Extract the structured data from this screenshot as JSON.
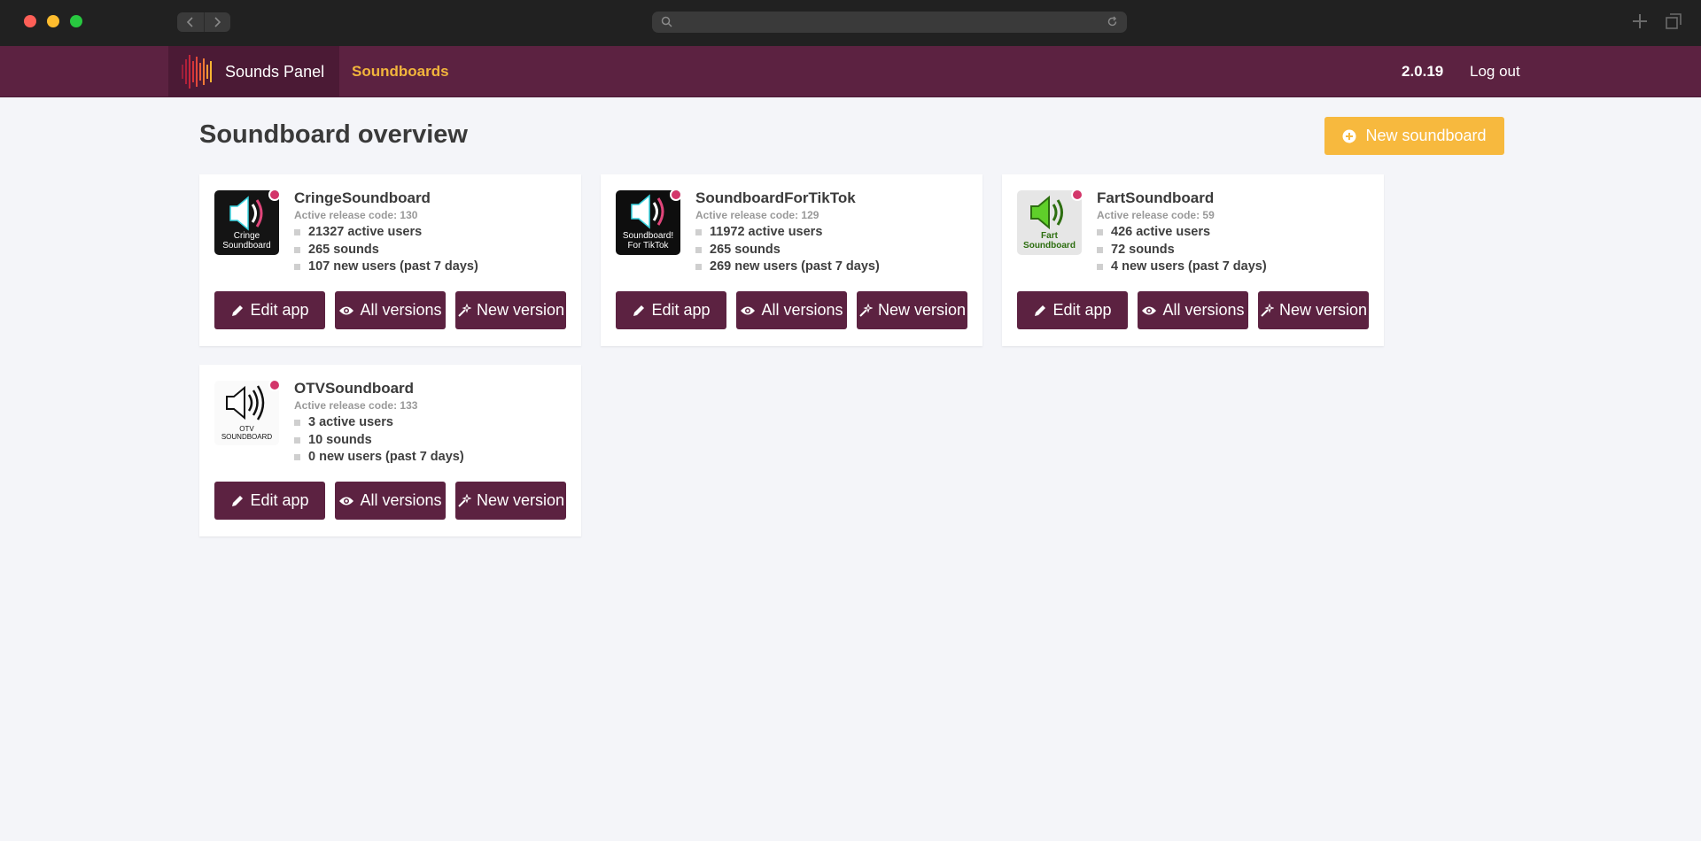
{
  "app": {
    "brand_name": "Sounds Panel",
    "nav_soundboards": "Soundboards",
    "version": "2.0.19",
    "logout": "Log out"
  },
  "colors": {
    "primary": "#5c2241",
    "accent": "#f7b93e",
    "nav_active": "#f2b53c"
  },
  "main": {
    "title": "Soundboard overview",
    "new_soundboard": "New soundboard"
  },
  "buttons": {
    "edit": "Edit app",
    "all_versions": "All versions",
    "new_version": "New version"
  },
  "cards": [
    {
      "name": "CringeSoundboard",
      "release": "Active release code: 130",
      "active_users": "21327 active users",
      "sounds": "265 sounds",
      "new_users": "107 new users (past 7 days)",
      "thumb_caption_1": "Cringe",
      "thumb_caption_2": "Soundboard"
    },
    {
      "name": "SoundboardForTikTok",
      "release": "Active release code: 129",
      "active_users": "11972 active users",
      "sounds": "265 sounds",
      "new_users": "269 new users (past 7 days)",
      "thumb_caption_1": "Soundboard!",
      "thumb_caption_2": "For TikTok"
    },
    {
      "name": "FartSoundboard",
      "release": "Active release code: 59",
      "active_users": "426 active users",
      "sounds": "72 sounds",
      "new_users": "4 new users (past 7 days)",
      "thumb_caption_1": "Fart",
      "thumb_caption_2": "Soundboard"
    },
    {
      "name": "OTVSoundboard",
      "release": "Active release code: 133",
      "active_users": "3 active users",
      "sounds": "10 sounds",
      "new_users": "0 new users (past 7 days)",
      "thumb_caption_1": "OTV",
      "thumb_caption_2": "SOUNDBOARD"
    }
  ]
}
